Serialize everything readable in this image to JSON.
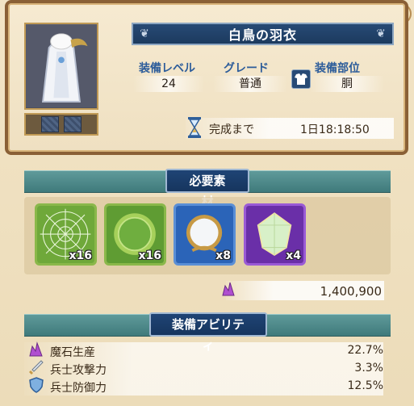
{
  "header": {
    "item_name": "白鳥の羽衣",
    "close_icon": "close-icon"
  },
  "stats": {
    "level_label": "装備レベル",
    "level_value": "24",
    "grade_label": "グレード",
    "grade_value": "普通",
    "part_label": "装備部位",
    "part_value": "胴",
    "part_icon": "armor-icon"
  },
  "timer": {
    "label": "完成まで",
    "value": "1日18:18:50",
    "icon": "hourglass-icon"
  },
  "materials_section": {
    "title": "必要素材",
    "items": [
      {
        "name": "spider-web-material",
        "count": "x16"
      },
      {
        "name": "green-ring-material",
        "count": "x16"
      },
      {
        "name": "mirror-material",
        "count": "x8"
      },
      {
        "name": "crystal-material",
        "count": "x4"
      }
    ],
    "cost_value": "1,400,900",
    "cost_icon": "magic-stone-icon"
  },
  "abilities_section": {
    "title": "装備アビリティ",
    "rows": [
      {
        "label": "魔石生産",
        "value": "22.7%",
        "icon": "magic-stone-icon"
      },
      {
        "label": "兵士攻撃力",
        "value": "3.3%",
        "icon": "sword-icon"
      },
      {
        "label": "兵士防御力",
        "value": "12.5%",
        "icon": "shield-icon"
      }
    ]
  },
  "colors": {
    "accent_blue": "#1f4475",
    "teal_band": "#4f8a8b",
    "panel_border": "#8a6036"
  }
}
